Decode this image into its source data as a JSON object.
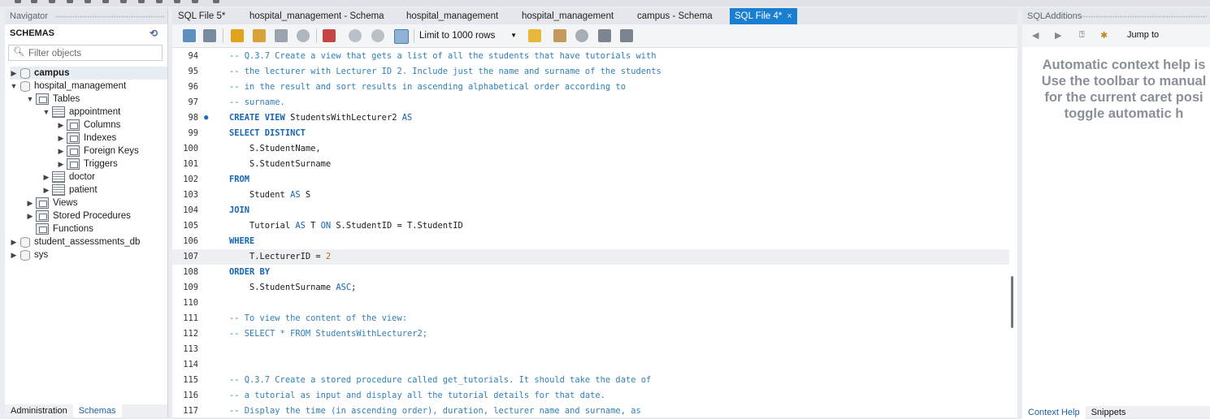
{
  "navigator": {
    "title": "Navigator",
    "schemas_label": "SCHEMAS",
    "filter_placeholder": "Filter objects",
    "tree": [
      {
        "label": "campus",
        "bold": true
      },
      {
        "label": "hospital_management"
      },
      {
        "label": "Tables"
      },
      {
        "label": "appointment"
      },
      {
        "label": "Columns"
      },
      {
        "label": "Indexes"
      },
      {
        "label": "Foreign Keys"
      },
      {
        "label": "Triggers"
      },
      {
        "label": "doctor"
      },
      {
        "label": "patient"
      },
      {
        "label": "Views"
      },
      {
        "label": "Stored Procedures"
      },
      {
        "label": "Functions"
      },
      {
        "label": "student_assessments_db"
      },
      {
        "label": "sys"
      }
    ],
    "bottom_tabs": [
      "Administration",
      "Schemas"
    ]
  },
  "tabs": [
    {
      "label": "SQL File 5*"
    },
    {
      "label": "hospital_management - Schema"
    },
    {
      "label": "hospital_management"
    },
    {
      "label": "hospital_management"
    },
    {
      "label": "campus - Schema"
    },
    {
      "label": "SQL File 4*",
      "active": true,
      "close": "×"
    }
  ],
  "toolbar": {
    "limit_label": "Limit to 1000 rows"
  },
  "editor": {
    "lines": [
      {
        "n": "94",
        "t": "-- Q.3.7 Create a view that gets a list of all the students that have tutorials with"
      },
      {
        "n": "95",
        "t": "-- the lecturer with Lecturer ID 2. Include just the name and surname of the students"
      },
      {
        "n": "96",
        "t": "-- in the result and sort results in ascending alphabetical order according to"
      },
      {
        "n": "97",
        "t": "-- surname."
      },
      {
        "n": "98",
        "t": "CREATE VIEW StudentsWithLecturer2 AS",
        "marker": "●"
      },
      {
        "n": "99",
        "t": "SELECT DISTINCT"
      },
      {
        "n": "100",
        "t": "    S.StudentName,"
      },
      {
        "n": "101",
        "t": "    S.StudentSurname"
      },
      {
        "n": "102",
        "t": "FROM"
      },
      {
        "n": "103",
        "t": "    Student AS S"
      },
      {
        "n": "104",
        "t": "JOIN"
      },
      {
        "n": "105",
        "t": "    Tutorial AS T ON S.StudentID = T.StudentID"
      },
      {
        "n": "106",
        "t": "WHERE"
      },
      {
        "n": "107",
        "t": "    T.LecturerID = 2",
        "current": true
      },
      {
        "n": "108",
        "t": "ORDER BY"
      },
      {
        "n": "109",
        "t": "    S.StudentSurname ASC;"
      },
      {
        "n": "110",
        "t": ""
      },
      {
        "n": "111",
        "t": "-- To view the content of the view:"
      },
      {
        "n": "112",
        "t": "-- SELECT * FROM StudentsWithLecturer2;"
      },
      {
        "n": "113",
        "t": ""
      },
      {
        "n": "114",
        "t": ""
      },
      {
        "n": "115",
        "t": "-- Q.3.7 Create a stored procedure called get_tutorials. It should take the date of"
      },
      {
        "n": "116",
        "t": "-- a tutorial as input and display all the tutorial details for that date."
      },
      {
        "n": "117",
        "t": "-- Display the time (in ascending order), duration, lecturer name and surname, as"
      }
    ]
  },
  "additions": {
    "title": "SQLAdditions",
    "jump_to": "Jump to",
    "help_lines": [
      "Automatic context help is",
      "Use the toolbar to manual",
      "for the current caret posi",
      "toggle automatic h"
    ],
    "bottom_tabs": [
      "Context Help",
      "Snippets"
    ]
  },
  "colors": {
    "accent": "#1a7fd1",
    "comment": "#2f7fb8",
    "keyword": "#1565b6"
  }
}
